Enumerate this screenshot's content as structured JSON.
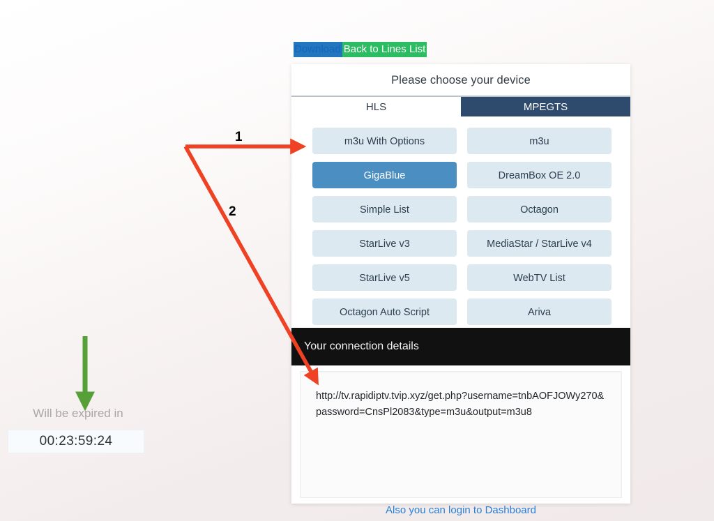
{
  "toplinks": {
    "download_label": "Download",
    "back_label": "Back to Lines List",
    "download_bg": "#2176bd",
    "back_bg": "#2cbd63"
  },
  "card": {
    "title": "Please choose your device",
    "tabs": [
      {
        "label": "HLS",
        "active": false
      },
      {
        "label": "MPEGTS",
        "active": true
      }
    ],
    "device_buttons": [
      {
        "label": "m3u With Options",
        "selected": false
      },
      {
        "label": "m3u",
        "selected": false
      },
      {
        "label": "GigaBlue",
        "selected": true
      },
      {
        "label": "DreamBox OE 2.0",
        "selected": false
      },
      {
        "label": "Simple List",
        "selected": false
      },
      {
        "label": "Octagon",
        "selected": false
      },
      {
        "label": "StarLive v3",
        "selected": false
      },
      {
        "label": "MediaStar / StarLive v4",
        "selected": false
      },
      {
        "label": "StarLive v5",
        "selected": false
      },
      {
        "label": "WebTV List",
        "selected": false
      },
      {
        "label": "Octagon Auto Script",
        "selected": false
      },
      {
        "label": "Ariva",
        "selected": false
      }
    ],
    "selected_color": "#4a8ec2",
    "button_color": "#dce9f0"
  },
  "connection": {
    "header": "Your connection details",
    "url": "http://tv.rapidiptv.tvip.xyz/get.php?username=tnbAOFJOWy270&password=CnsPl2083&type=m3u&output=m3u8",
    "header_bg": "#111111"
  },
  "dashboard_link": {
    "label": "Also you can login to Dashboard",
    "color": "#2b7fd4"
  },
  "expiry": {
    "label": "Will be expired in",
    "timer": "00:23:59:24"
  },
  "annotations": {
    "arrow_color": "#ef4123",
    "down_arrow_color": "#57a038",
    "markers": [
      {
        "number": "1"
      },
      {
        "number": "2"
      }
    ]
  }
}
